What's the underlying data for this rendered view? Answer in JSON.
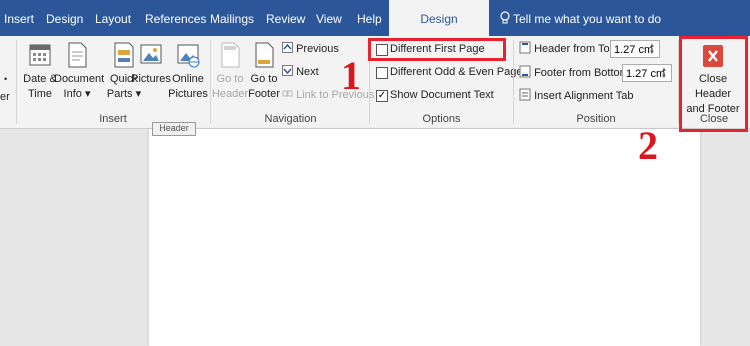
{
  "tabs": [
    "Insert",
    "Design",
    "Layout",
    "References",
    "Mailings",
    "Review",
    "View",
    "Help"
  ],
  "active_tab": "Design",
  "tell_me": "Tell me what you want to do",
  "left_fragment": "er",
  "insert": {
    "label": "Insert",
    "date_time": "Date &\nTime",
    "document_info": "Document\nInfo",
    "quick_parts": "Quick\nParts",
    "pictures": "Pictures",
    "online_pictures": "Online\nPictures"
  },
  "navigation": {
    "label": "Navigation",
    "go_to_header": "Go to\nHeader",
    "go_to_footer": "Go to\nFooter",
    "previous": "Previous",
    "next": "Next",
    "link_to_previous": "Link to Previous"
  },
  "options": {
    "label": "Options",
    "different_first_page": "Different First Page",
    "different_odd_even": "Different Odd & Even Pages",
    "show_document_text": "Show Document Text",
    "show_document_text_checked": true
  },
  "position": {
    "label": "Position",
    "header_from_top": "Header from Top:",
    "header_value": "1.27 cm",
    "footer_from_bottom": "Footer from Bottom:",
    "footer_value": "1.27 cm",
    "insert_alignment_tab": "Insert Alignment Tab"
  },
  "close": {
    "label": "Close",
    "button": "Close Header\nand Footer"
  },
  "header_tag": "Header",
  "annotations": [
    "1",
    "2"
  ],
  "colors": {
    "ribbon_blue": "#2b579a",
    "highlight_red": "#e8222f",
    "close_icon_red": "#d9473d"
  }
}
